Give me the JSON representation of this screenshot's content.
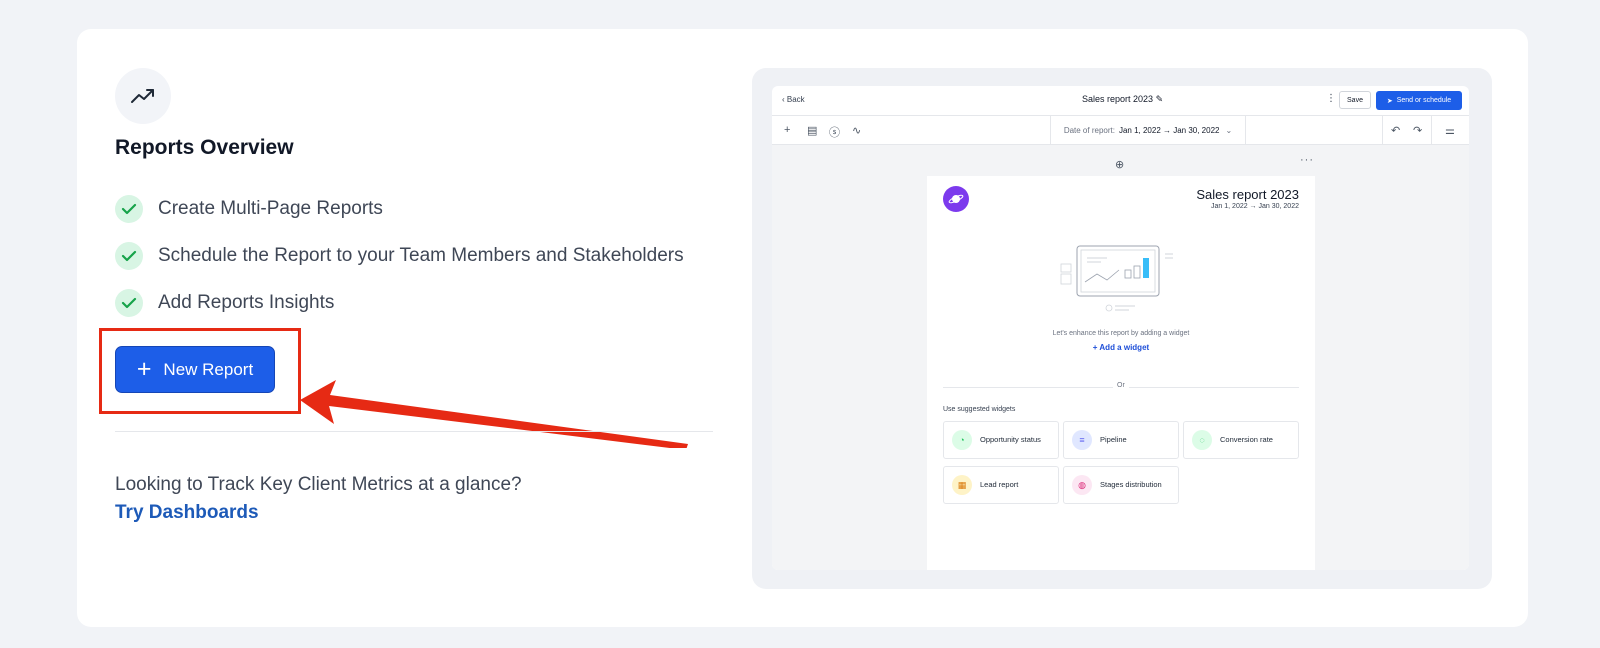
{
  "overview": {
    "icon": "trending-up-icon",
    "title": "Reports Overview",
    "features": [
      "Create Multi-Page Reports",
      "Schedule the Report to your Team Members and Stakeholders",
      "Add Reports Insights"
    ],
    "new_report_label": "New Report",
    "bottom_question": "Looking to Track Key Client Metrics at a glance?",
    "bottom_link": "Try Dashboards"
  },
  "preview": {
    "back_label": "Back",
    "doc_title": "Sales report 2023",
    "save_label": "Save",
    "send_label": "Send or schedule",
    "date_label": "Date of report:",
    "date_value": "Jan 1, 2022 → Jan 30, 2022",
    "page_title": "Sales report 2023",
    "page_date": "Jan 1, 2022 → Jan 30, 2022",
    "enhance_text": "Let's enhance this report by adding a widget",
    "add_widget_label": "Add a widget",
    "or_label": "Or",
    "suggested_label": "Use suggested widgets",
    "widgets": [
      {
        "label": "Opportunity status",
        "icon": "pie-chart-icon",
        "color": "#22c55e",
        "bg": "#dcfce7"
      },
      {
        "label": "Pipeline",
        "icon": "filter-list-icon",
        "color": "#6366f1",
        "bg": "#e0e7ff"
      },
      {
        "label": "Conversion rate",
        "icon": "refresh-circle-icon",
        "color": "#22c55e",
        "bg": "#dcfce7"
      },
      {
        "label": "Lead report",
        "icon": "chart-file-icon",
        "color": "#d97706",
        "bg": "#fef3c7"
      },
      {
        "label": "Stages distribution",
        "icon": "donut-icon",
        "color": "#db2777",
        "bg": "#fce7f3"
      }
    ]
  },
  "colors": {
    "accent": "#1d5ee8",
    "highlight": "#e62a14",
    "check_bg": "#d8f5e4",
    "check": "#16a34a",
    "link": "#1d5ab8"
  }
}
